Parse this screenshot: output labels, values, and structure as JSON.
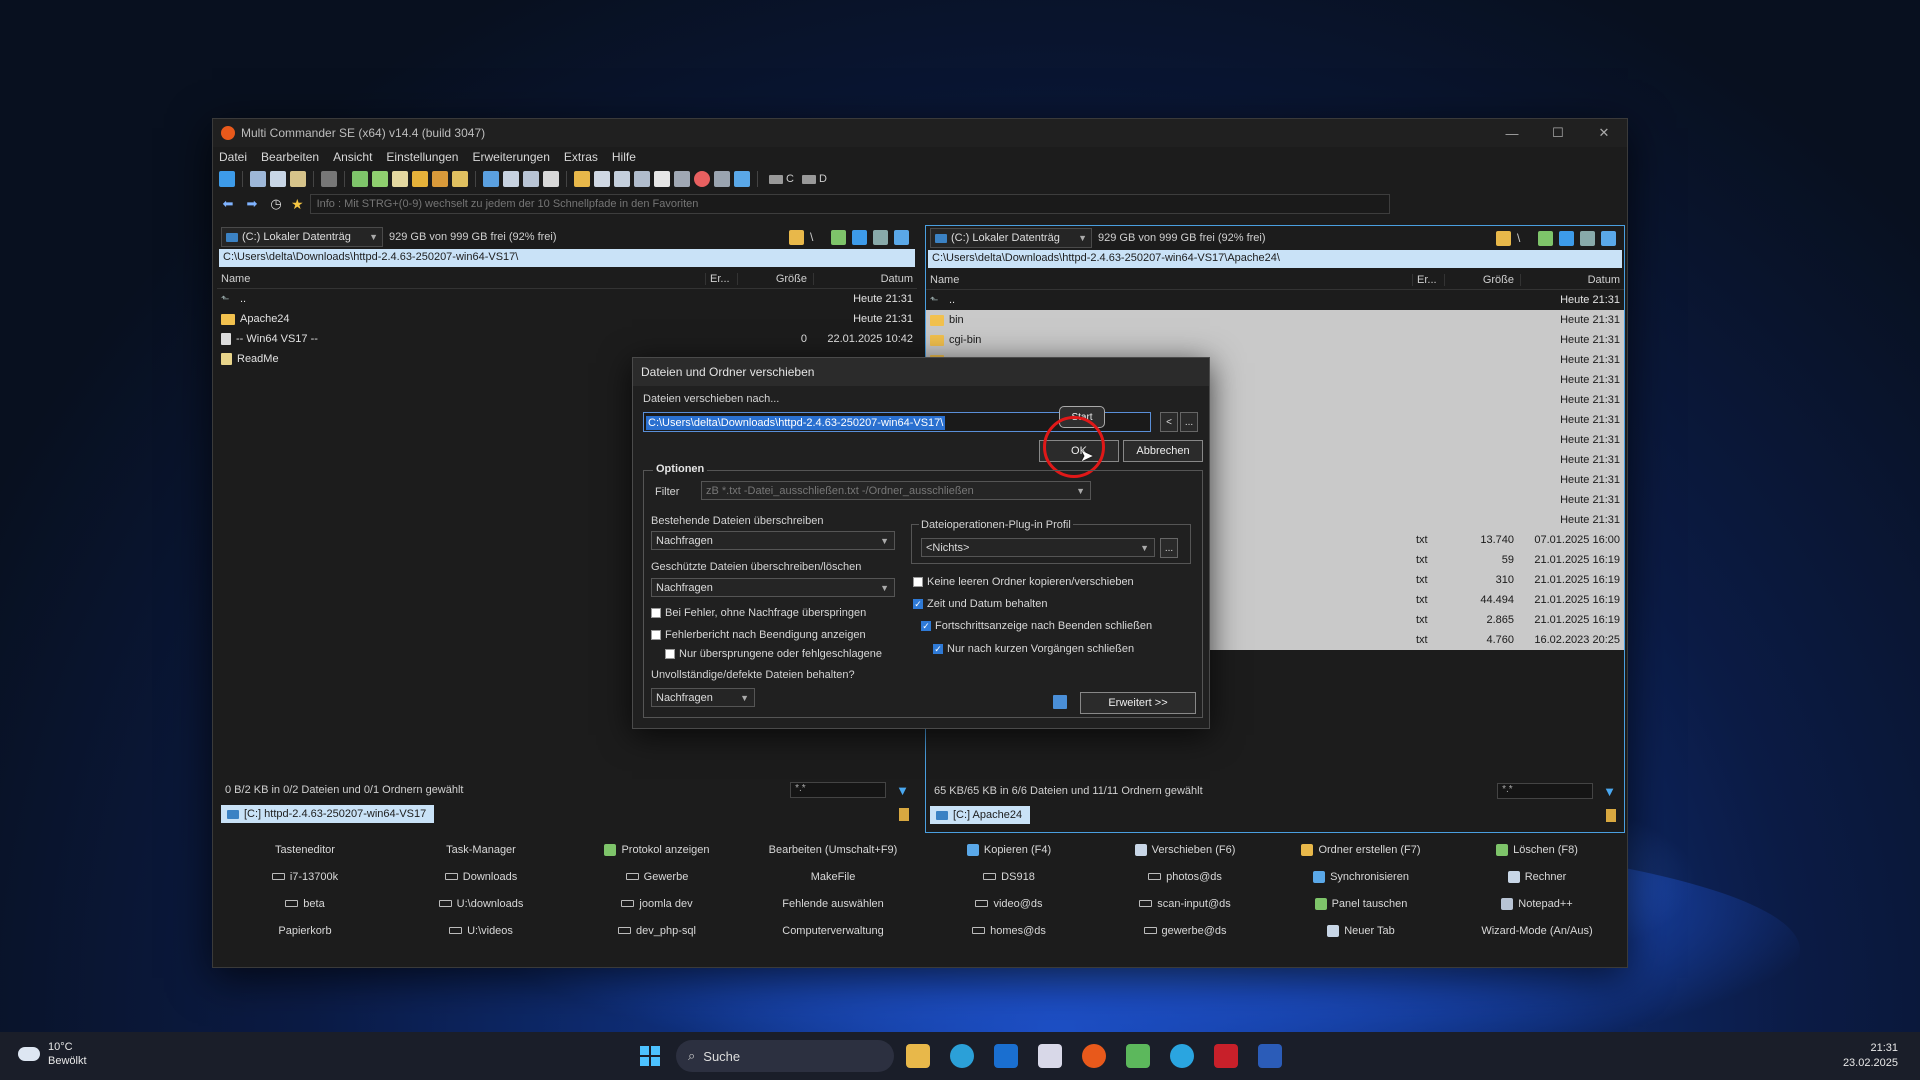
{
  "window": {
    "title": "Multi Commander SE (x64)  v14.4 (build 3047)",
    "controls": [
      "—",
      "☐",
      "✕"
    ]
  },
  "menu": [
    "Datei",
    "Bearbeiten",
    "Ansicht",
    "Einstellungen",
    "Erweiterungen",
    "Extras",
    "Hilfe"
  ],
  "toolbar": {
    "drive_c": "C",
    "drive_d": "D"
  },
  "infobar": {
    "text": "Info : Mit STRG+(0-9) wechselt zu jedem der 10 Schnellpfade in den Favoriten"
  },
  "left_panel": {
    "drive": "(C:) Lokaler Datenträg",
    "free": "929 GB von 999 GB frei (92% frei)",
    "path": "C:\\Users\\delta\\Downloads\\httpd-2.4.63-250207-win64-VS17\\",
    "columns": {
      "name": "Name",
      "ext": "Er...",
      "size": "Größe",
      "date": "Datum"
    },
    "rows": [
      {
        "name": "..",
        "ext": "",
        "size": "",
        "date": "Heute 21:31"
      },
      {
        "name": "Apache24",
        "ext": "",
        "size": "",
        "date": "Heute 21:31"
      },
      {
        "name": "-- Win64 VS17  --",
        "ext": "",
        "size": "0",
        "date": "22.01.2025 10:42"
      },
      {
        "name": "ReadMe",
        "ext": "",
        "size": "",
        "date": ""
      }
    ],
    "status": "0 B/2 KB in 0/2 Dateien und 0/1 Ordnern gewählt",
    "filter": "*.*",
    "tab": "[C:] httpd-2.4.63-250207-win64-VS17"
  },
  "right_panel": {
    "drive": "(C:) Lokaler Datenträg",
    "free": "929 GB von 999 GB frei (92% frei)",
    "path": "C:\\Users\\delta\\Downloads\\httpd-2.4.63-250207-win64-VS17\\Apache24\\",
    "columns": {
      "name": "Name",
      "ext": "Er...",
      "size": "Größe",
      "date": "Datum"
    },
    "rows": [
      {
        "name": "..",
        "ext": "",
        "size": "",
        "date": "Heute 21:31"
      },
      {
        "name": "bin",
        "ext": "",
        "size": "",
        "date": "Heute 21:31"
      },
      {
        "name": "cgi-bin",
        "ext": "",
        "size": "",
        "date": "Heute 21:31"
      },
      {
        "name": "",
        "ext": "",
        "size": "",
        "date": "Heute 21:31"
      },
      {
        "name": "",
        "ext": "",
        "size": "",
        "date": "Heute 21:31"
      },
      {
        "name": "",
        "ext": "",
        "size": "",
        "date": "Heute 21:31"
      },
      {
        "name": "",
        "ext": "",
        "size": "",
        "date": "Heute 21:31"
      },
      {
        "name": "",
        "ext": "",
        "size": "",
        "date": "Heute 21:31"
      },
      {
        "name": "",
        "ext": "",
        "size": "",
        "date": "Heute 21:31"
      },
      {
        "name": "",
        "ext": "",
        "size": "",
        "date": "Heute 21:31"
      },
      {
        "name": "",
        "ext": "",
        "size": "",
        "date": "Heute 21:31"
      },
      {
        "name": "",
        "ext": "",
        "size": "",
        "date": "Heute 21:31"
      },
      {
        "name": "",
        "ext": "txt",
        "size": "13.740",
        "date": "07.01.2025 16:00"
      },
      {
        "name": "",
        "ext": "txt",
        "size": "59",
        "date": "21.01.2025 16:19"
      },
      {
        "name": "",
        "ext": "txt",
        "size": "310",
        "date": "21.01.2025 16:19"
      },
      {
        "name": "",
        "ext": "txt",
        "size": "44.494",
        "date": "21.01.2025 16:19"
      },
      {
        "name": "",
        "ext": "txt",
        "size": "2.865",
        "date": "21.01.2025 16:19"
      },
      {
        "name": "",
        "ext": "txt",
        "size": "4.760",
        "date": "16.02.2023 20:25"
      }
    ],
    "status": "65 KB/65 KB in 6/6 Dateien und 11/11 Ordnern gewählt",
    "filter": "*.*",
    "tab": "[C:] Apache24"
  },
  "buttons": [
    "Tasteneditor",
    "Task-Manager",
    "Protokol anzeigen",
    "Bearbeiten (Umschalt+F9)",
    "Kopieren (F4)",
    "Verschieben (F6)",
    "Ordner erstellen (F7)",
    "Löschen (F8)",
    "i7-13700k",
    "Downloads",
    "Gewerbe",
    "MakeFile",
    "DS918",
    "photos@ds",
    "Synchronisieren",
    "Rechner",
    "beta",
    "U:\\downloads",
    "joomla dev",
    "Fehlende auswählen",
    "video@ds",
    "scan-input@ds",
    "Panel tauschen",
    "Notepad++",
    "Papierkorb",
    "U:\\videos",
    "dev_php-sql",
    "Computerverwaltung",
    "homes@ds",
    "gewerbe@ds",
    "Neuer Tab",
    "Wizard-Mode (An/Aus)"
  ],
  "dialog": {
    "title": "Dateien und Ordner verschieben",
    "move_to_label": "Dateien verschieben nach...",
    "path": "C:\\Users\\delta\\Downloads\\httpd-2.4.63-250207-win64-VS17\\",
    "tooltip": "Start",
    "ok": "OK",
    "cancel": "Abbrechen",
    "browse_back": "<",
    "browse_more": "...",
    "options_legend": "Optionen",
    "filter_label": "Filter",
    "filter_placeholder": "zB *.txt -Datei_ausschließen.txt -/Ordner_ausschließen",
    "overwrite_label": "Bestehende Dateien überschreiben",
    "overwrite_value": "Nachfragen",
    "protected_label": "Geschützte Dateien überschreiben/löschen",
    "protected_value": "Nachfragen",
    "chk_skip_errors": "Bei Fehler, ohne Nachfrage überspringen",
    "chk_error_report": "Fehlerbericht nach Beendigung anzeigen",
    "chk_only_skipped": "Nur übersprungene oder fehlgeschlagene",
    "incomplete_label": "Unvollständige/defekte Dateien behalten?",
    "incomplete_value": "Nachfragen",
    "plugin_label": "Dateioperationen-Plug-in Profil",
    "plugin_value": "<Nichts>",
    "chk_no_empty": "Keine leeren Ordner kopieren/verschieben",
    "chk_keep_time": "Zeit und Datum behalten",
    "chk_close_progress": "Fortschrittsanzeige nach Beenden schließen",
    "chk_only_short": "Nur nach kurzen Vorgängen schließen",
    "advanced": "Erweitert >>"
  },
  "taskbar": {
    "temp": "10°C",
    "weather": "Bewölkt",
    "search": "Suche",
    "time": "21:31",
    "date": "23.02.2025"
  }
}
